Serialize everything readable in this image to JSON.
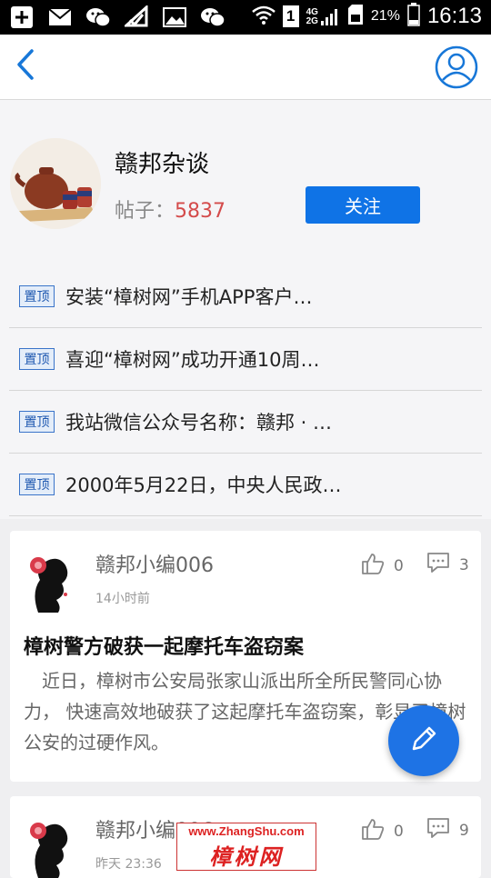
{
  "status_bar": {
    "battery_percent": "21%",
    "time": "16:13",
    "sim_slot": "1",
    "network_top": "4G",
    "network_bottom": "2G",
    "icons": [
      "add-icon",
      "mail-icon",
      "wechat-icon",
      "signal-check-icon",
      "image-icon",
      "wechat-icon",
      "wifi-icon",
      "sim-icon",
      "signal-icon",
      "battery-icon"
    ]
  },
  "header": {
    "back_icon": "back-arrow-icon",
    "user_icon": "user-profile-icon"
  },
  "forum": {
    "name": "赣邦杂谈",
    "posts_label": "帖子：",
    "posts_count": "5837",
    "follow_label": "关注"
  },
  "pinned": [
    {
      "badge": "置顶",
      "title": "安装“樟树网”手机APP客户…"
    },
    {
      "badge": "置顶",
      "title": "喜迎“樟树网”成功开通10周…"
    },
    {
      "badge": "置顶",
      "title": "我站微信公众号名称：赣邦 · …"
    },
    {
      "badge": "置顶",
      "title": "2000年5月22日，中央人民政…"
    }
  ],
  "posts": [
    {
      "author": "赣邦小编006",
      "time": "14小时前",
      "likes": "0",
      "comments": "3",
      "title": "樟树警方破获一起摩托车盗窃案",
      "body": "　近日，樟树市公安局张家山派出所全所民警同心协力， 快速高效地破获了这起摩托车盗窃案，彰显了樟树公安的过硬作风。"
    },
    {
      "author": "赣邦小编006",
      "time": "昨天 23:36",
      "likes": "0",
      "comments": "9"
    }
  ],
  "fab": {
    "icon": "pencil-icon"
  },
  "watermark": {
    "url": "www.ZhangShu.com",
    "logo": "樟树网"
  },
  "colors": {
    "accent": "#0f73e6",
    "count_red": "#d44b4b",
    "badge_blue": "#1d57b0"
  }
}
